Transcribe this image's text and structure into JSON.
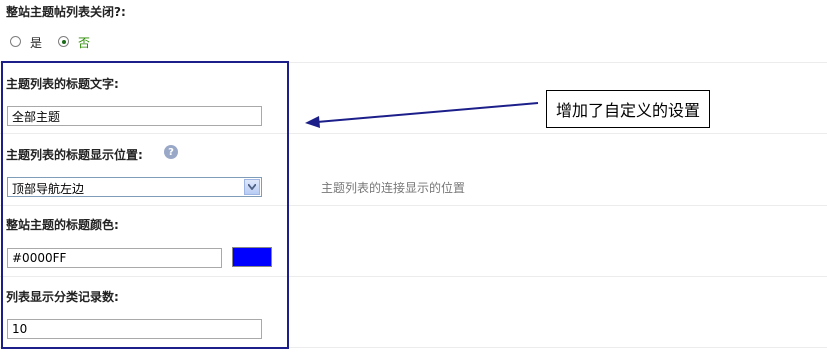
{
  "sections": {
    "close_list": {
      "label": "整站主题帖列表关闭?:",
      "options": [
        {
          "label": "是",
          "checked": false
        },
        {
          "label": "否",
          "checked": true
        }
      ]
    },
    "title_text": {
      "label": "主题列表的标题文字:",
      "value": "全部主题"
    },
    "title_position": {
      "label": "主题列表的标题显示位置:",
      "selected": "顶部导航左边",
      "hint": "主题列表的连接显示的位置"
    },
    "title_color": {
      "label": "整站主题的标题颜色:",
      "value": "#0000FF",
      "swatch_color": "#0000FF"
    },
    "record_count": {
      "label": "列表显示分类记录数:",
      "value": "10"
    }
  },
  "annotation": {
    "callout_text": "增加了自定义的设置",
    "box_color": "#1c1f8a",
    "arrow_color": "#1c1f8a"
  }
}
